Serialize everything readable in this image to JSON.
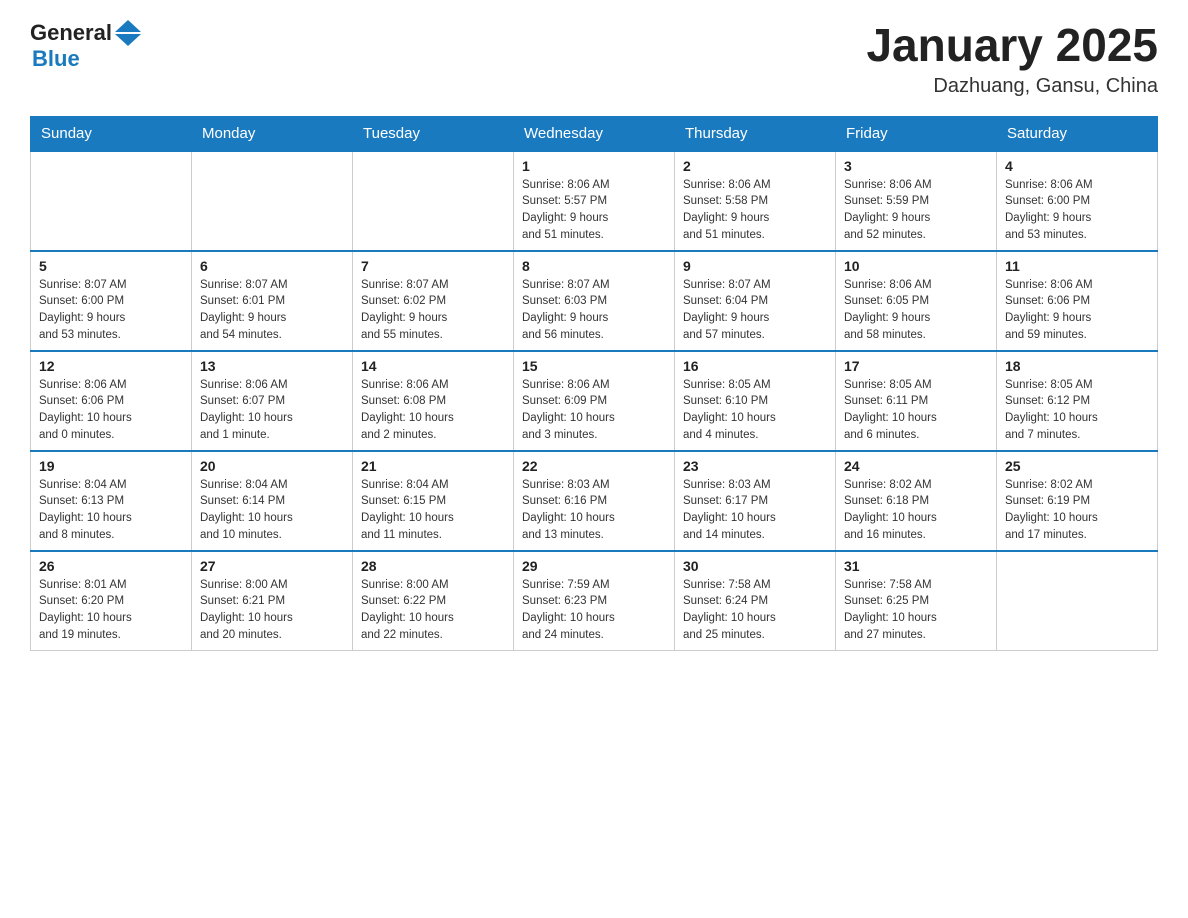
{
  "header": {
    "logo": {
      "text_general": "General",
      "text_blue": "Blue"
    },
    "month_title": "January 2025",
    "location": "Dazhuang, Gansu, China"
  },
  "weekdays": [
    "Sunday",
    "Monday",
    "Tuesday",
    "Wednesday",
    "Thursday",
    "Friday",
    "Saturday"
  ],
  "weeks": [
    [
      {
        "day": "",
        "info": ""
      },
      {
        "day": "",
        "info": ""
      },
      {
        "day": "",
        "info": ""
      },
      {
        "day": "1",
        "info": "Sunrise: 8:06 AM\nSunset: 5:57 PM\nDaylight: 9 hours\nand 51 minutes."
      },
      {
        "day": "2",
        "info": "Sunrise: 8:06 AM\nSunset: 5:58 PM\nDaylight: 9 hours\nand 51 minutes."
      },
      {
        "day": "3",
        "info": "Sunrise: 8:06 AM\nSunset: 5:59 PM\nDaylight: 9 hours\nand 52 minutes."
      },
      {
        "day": "4",
        "info": "Sunrise: 8:06 AM\nSunset: 6:00 PM\nDaylight: 9 hours\nand 53 minutes."
      }
    ],
    [
      {
        "day": "5",
        "info": "Sunrise: 8:07 AM\nSunset: 6:00 PM\nDaylight: 9 hours\nand 53 minutes."
      },
      {
        "day": "6",
        "info": "Sunrise: 8:07 AM\nSunset: 6:01 PM\nDaylight: 9 hours\nand 54 minutes."
      },
      {
        "day": "7",
        "info": "Sunrise: 8:07 AM\nSunset: 6:02 PM\nDaylight: 9 hours\nand 55 minutes."
      },
      {
        "day": "8",
        "info": "Sunrise: 8:07 AM\nSunset: 6:03 PM\nDaylight: 9 hours\nand 56 minutes."
      },
      {
        "day": "9",
        "info": "Sunrise: 8:07 AM\nSunset: 6:04 PM\nDaylight: 9 hours\nand 57 minutes."
      },
      {
        "day": "10",
        "info": "Sunrise: 8:06 AM\nSunset: 6:05 PM\nDaylight: 9 hours\nand 58 minutes."
      },
      {
        "day": "11",
        "info": "Sunrise: 8:06 AM\nSunset: 6:06 PM\nDaylight: 9 hours\nand 59 minutes."
      }
    ],
    [
      {
        "day": "12",
        "info": "Sunrise: 8:06 AM\nSunset: 6:06 PM\nDaylight: 10 hours\nand 0 minutes."
      },
      {
        "day": "13",
        "info": "Sunrise: 8:06 AM\nSunset: 6:07 PM\nDaylight: 10 hours\nand 1 minute."
      },
      {
        "day": "14",
        "info": "Sunrise: 8:06 AM\nSunset: 6:08 PM\nDaylight: 10 hours\nand 2 minutes."
      },
      {
        "day": "15",
        "info": "Sunrise: 8:06 AM\nSunset: 6:09 PM\nDaylight: 10 hours\nand 3 minutes."
      },
      {
        "day": "16",
        "info": "Sunrise: 8:05 AM\nSunset: 6:10 PM\nDaylight: 10 hours\nand 4 minutes."
      },
      {
        "day": "17",
        "info": "Sunrise: 8:05 AM\nSunset: 6:11 PM\nDaylight: 10 hours\nand 6 minutes."
      },
      {
        "day": "18",
        "info": "Sunrise: 8:05 AM\nSunset: 6:12 PM\nDaylight: 10 hours\nand 7 minutes."
      }
    ],
    [
      {
        "day": "19",
        "info": "Sunrise: 8:04 AM\nSunset: 6:13 PM\nDaylight: 10 hours\nand 8 minutes."
      },
      {
        "day": "20",
        "info": "Sunrise: 8:04 AM\nSunset: 6:14 PM\nDaylight: 10 hours\nand 10 minutes."
      },
      {
        "day": "21",
        "info": "Sunrise: 8:04 AM\nSunset: 6:15 PM\nDaylight: 10 hours\nand 11 minutes."
      },
      {
        "day": "22",
        "info": "Sunrise: 8:03 AM\nSunset: 6:16 PM\nDaylight: 10 hours\nand 13 minutes."
      },
      {
        "day": "23",
        "info": "Sunrise: 8:03 AM\nSunset: 6:17 PM\nDaylight: 10 hours\nand 14 minutes."
      },
      {
        "day": "24",
        "info": "Sunrise: 8:02 AM\nSunset: 6:18 PM\nDaylight: 10 hours\nand 16 minutes."
      },
      {
        "day": "25",
        "info": "Sunrise: 8:02 AM\nSunset: 6:19 PM\nDaylight: 10 hours\nand 17 minutes."
      }
    ],
    [
      {
        "day": "26",
        "info": "Sunrise: 8:01 AM\nSunset: 6:20 PM\nDaylight: 10 hours\nand 19 minutes."
      },
      {
        "day": "27",
        "info": "Sunrise: 8:00 AM\nSunset: 6:21 PM\nDaylight: 10 hours\nand 20 minutes."
      },
      {
        "day": "28",
        "info": "Sunrise: 8:00 AM\nSunset: 6:22 PM\nDaylight: 10 hours\nand 22 minutes."
      },
      {
        "day": "29",
        "info": "Sunrise: 7:59 AM\nSunset: 6:23 PM\nDaylight: 10 hours\nand 24 minutes."
      },
      {
        "day": "30",
        "info": "Sunrise: 7:58 AM\nSunset: 6:24 PM\nDaylight: 10 hours\nand 25 minutes."
      },
      {
        "day": "31",
        "info": "Sunrise: 7:58 AM\nSunset: 6:25 PM\nDaylight: 10 hours\nand 27 minutes."
      },
      {
        "day": "",
        "info": ""
      }
    ]
  ]
}
